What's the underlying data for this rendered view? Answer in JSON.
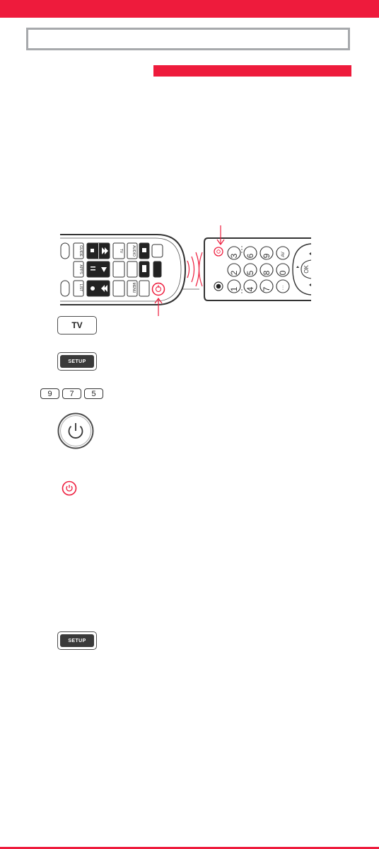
{
  "header": {
    "accent_color": "#ee1b3c"
  },
  "title_box": {
    "text": ""
  },
  "section_header": {
    "text": ""
  },
  "buttons": {
    "tv_label": "TV",
    "setup_label": "SETUP",
    "setup_label_2": "SETUP"
  },
  "code_digits": [
    "9",
    "7",
    "5"
  ],
  "remote_keys": {
    "numbers": [
      "3",
      "6",
      "9",
      "2",
      "5",
      "8",
      "0",
      "1",
      "4",
      "7"
    ],
    "av": "AV",
    "ok": "OK",
    "small_labels": [
      "TV",
      "APPS",
      "LIST",
      "GUIDE",
      "MENU"
    ]
  },
  "icons": {
    "power_button": "power-icon",
    "power_indicator": "power-led-icon",
    "signal": "ir-signal-icon",
    "arrow": "arrow-icon"
  }
}
